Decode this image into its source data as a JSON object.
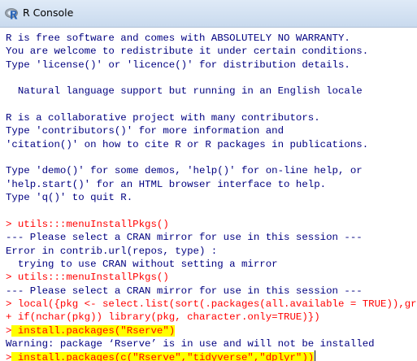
{
  "window": {
    "title": "R Console"
  },
  "console": {
    "lines": [
      {
        "kind": "out",
        "text": "R is free software and comes with ABSOLUTELY NO WARRANTY."
      },
      {
        "kind": "out",
        "text": "You are welcome to redistribute it under certain conditions."
      },
      {
        "kind": "out",
        "text": "Type 'license()' or 'licence()' for distribution details."
      },
      {
        "kind": "blank",
        "text": ""
      },
      {
        "kind": "out",
        "text": "  Natural language support but running in an English locale"
      },
      {
        "kind": "blank",
        "text": ""
      },
      {
        "kind": "out",
        "text": "R is a collaborative project with many contributors."
      },
      {
        "kind": "out",
        "text": "Type 'contributors()' for more information and"
      },
      {
        "kind": "out",
        "text": "'citation()' on how to cite R or R packages in publications."
      },
      {
        "kind": "blank",
        "text": ""
      },
      {
        "kind": "out",
        "text": "Type 'demo()' for some demos, 'help()' for on-line help, or"
      },
      {
        "kind": "out",
        "text": "'help.start()' for an HTML browser interface to help."
      },
      {
        "kind": "out",
        "text": "Type 'q()' to quit R."
      },
      {
        "kind": "blank",
        "text": ""
      },
      {
        "kind": "cmd",
        "text": "> utils:::menuInstallPkgs()"
      },
      {
        "kind": "out",
        "text": "--- Please select a CRAN mirror for use in this session ---"
      },
      {
        "kind": "out",
        "text": "Error in contrib.url(repos, type) :"
      },
      {
        "kind": "out",
        "text": "  trying to use CRAN without setting a mirror"
      },
      {
        "kind": "cmd",
        "text": "> utils:::menuInstallPkgs()"
      },
      {
        "kind": "out",
        "text": "--- Please select a CRAN mirror for use in this session ---"
      },
      {
        "kind": "cmd",
        "text": "> local({pkg <- select.list(sort(.packages(all.available = TRUE)),graphics=TRUE)"
      },
      {
        "kind": "cmd",
        "text": "+ if(nchar(pkg)) library(pkg, character.only=TRUE)})"
      },
      {
        "kind": "cmd-hl",
        "prompt": ">",
        "text": " install.packages(\"Rserve\")"
      },
      {
        "kind": "out",
        "text": "Warning: package ‘Rserve’ is in use and will not be installed"
      },
      {
        "kind": "cmd-hl-active",
        "prompt": ">",
        "text": " install.packages(c(\"Rserve\",\"tidyverse\",\"dplyr\"))"
      }
    ]
  }
}
